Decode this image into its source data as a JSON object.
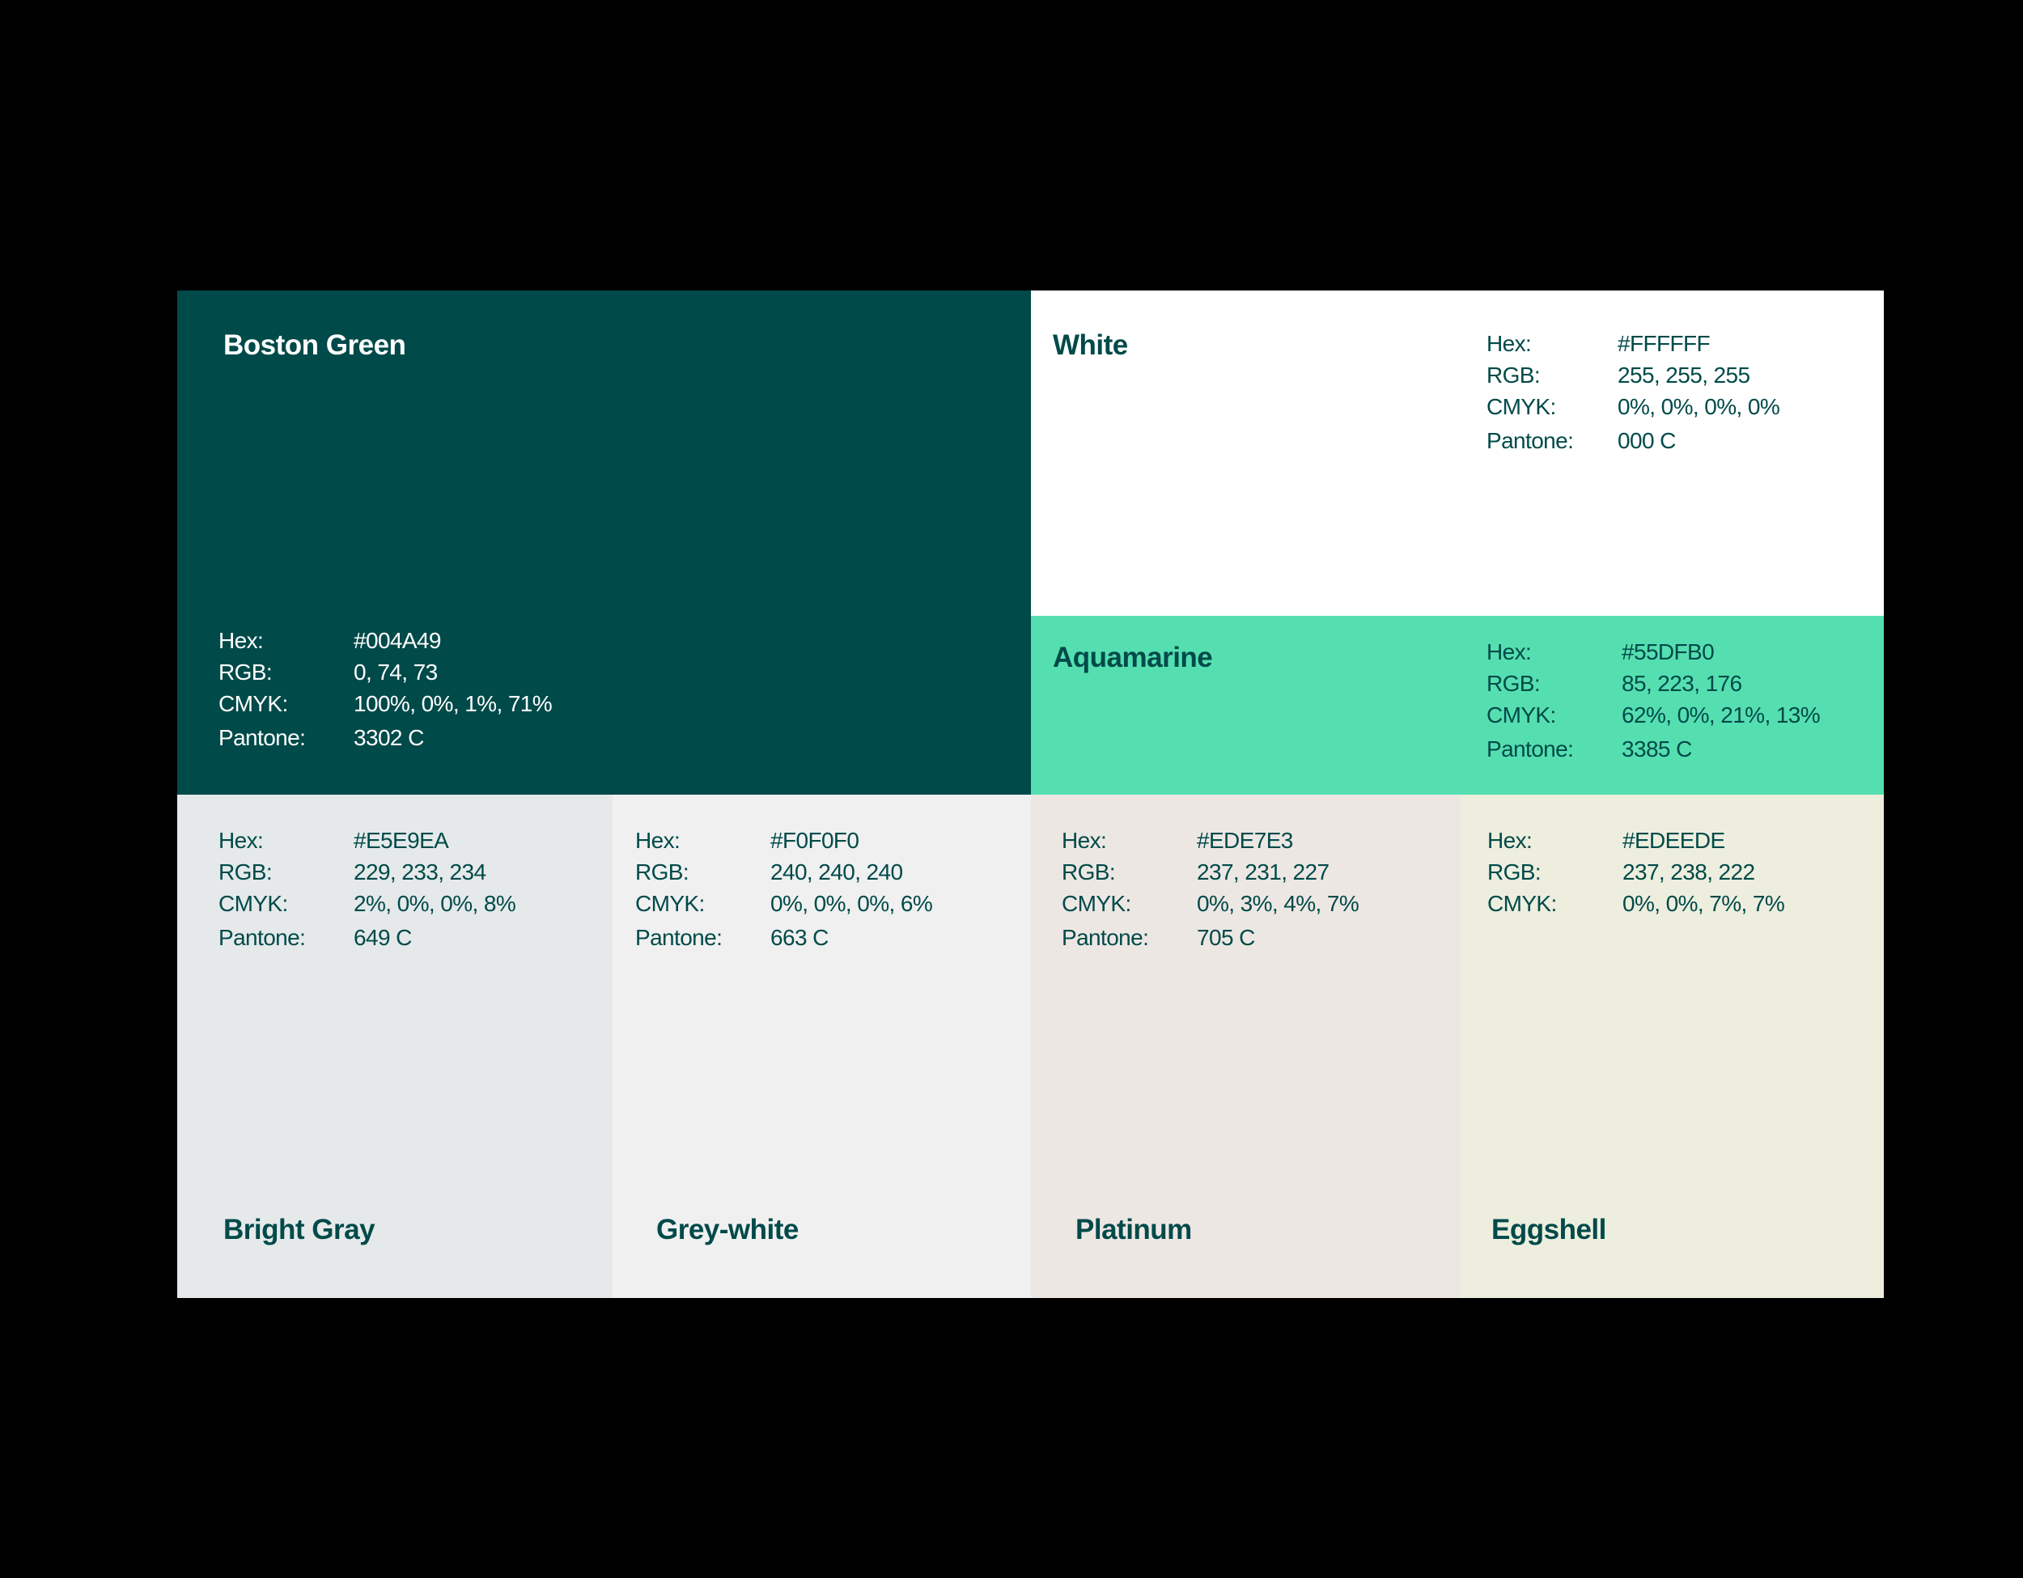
{
  "swatches": {
    "boston_green": {
      "name": "Boston Green",
      "color": "#004A49",
      "hex_label": "Hex:",
      "hex": "#004A49",
      "rgb_label": "RGB:",
      "rgb": "0, 74, 73",
      "cmyk_label": "CMYK:",
      "cmyk": "100%, 0%, 1%, 71%",
      "pantone_label": "Pantone:",
      "pantone": "3302 C"
    },
    "white": {
      "name": "White",
      "color": "#FFFFFF",
      "hex_label": "Hex:",
      "hex": "#FFFFFF",
      "rgb_label": "RGB:",
      "rgb": "255, 255, 255",
      "cmyk_label": "CMYK:",
      "cmyk": "0%, 0%, 0%, 0%",
      "pantone_label": "Pantone:",
      "pantone": "000 C"
    },
    "aquamarine": {
      "name": "Aquamarine",
      "color": "#55DFB0",
      "hex_label": "Hex:",
      "hex": "#55DFB0",
      "rgb_label": "RGB:",
      "rgb": "85, 223, 176",
      "cmyk_label": "CMYK:",
      "cmyk": "62%, 0%, 21%, 13%",
      "pantone_label": "Pantone:",
      "pantone": "3385 C"
    },
    "bright_gray": {
      "name": "Bright Gray",
      "color": "#E5E9EA",
      "hex_label": "Hex:",
      "hex": "#E5E9EA",
      "rgb_label": "RGB:",
      "rgb": "229, 233, 234",
      "cmyk_label": "CMYK:",
      "cmyk": "2%, 0%, 0%, 8%",
      "pantone_label": "Pantone:",
      "pantone": "649 C"
    },
    "grey_white": {
      "name": "Grey-white",
      "color": "#F0F0F0",
      "hex_label": "Hex:",
      "hex": "#F0F0F0",
      "rgb_label": "RGB:",
      "rgb": "240, 240, 240",
      "cmyk_label": "CMYK:",
      "cmyk": "0%, 0%, 0%, 6%",
      "pantone_label": "Pantone:",
      "pantone": "663 C"
    },
    "platinum": {
      "name": "Platinum",
      "color": "#EDE7E3",
      "hex_label": "Hex:",
      "hex": "#EDE7E3",
      "rgb_label": "RGB:",
      "rgb": "237, 231, 227",
      "cmyk_label": "CMYK:",
      "cmyk": "0%, 3%, 4%, 7%",
      "pantone_label": "Pantone:",
      "pantone": "705 C"
    },
    "eggshell": {
      "name": "Eggshell",
      "color": "#EDEEDE",
      "hex_label": "Hex:",
      "hex": "#EDEEDE",
      "rgb_label": "RGB:",
      "rgb": "237, 238, 222",
      "cmyk_label": "CMYK:",
      "cmyk": "0%, 0%, 7%, 7%"
    }
  }
}
